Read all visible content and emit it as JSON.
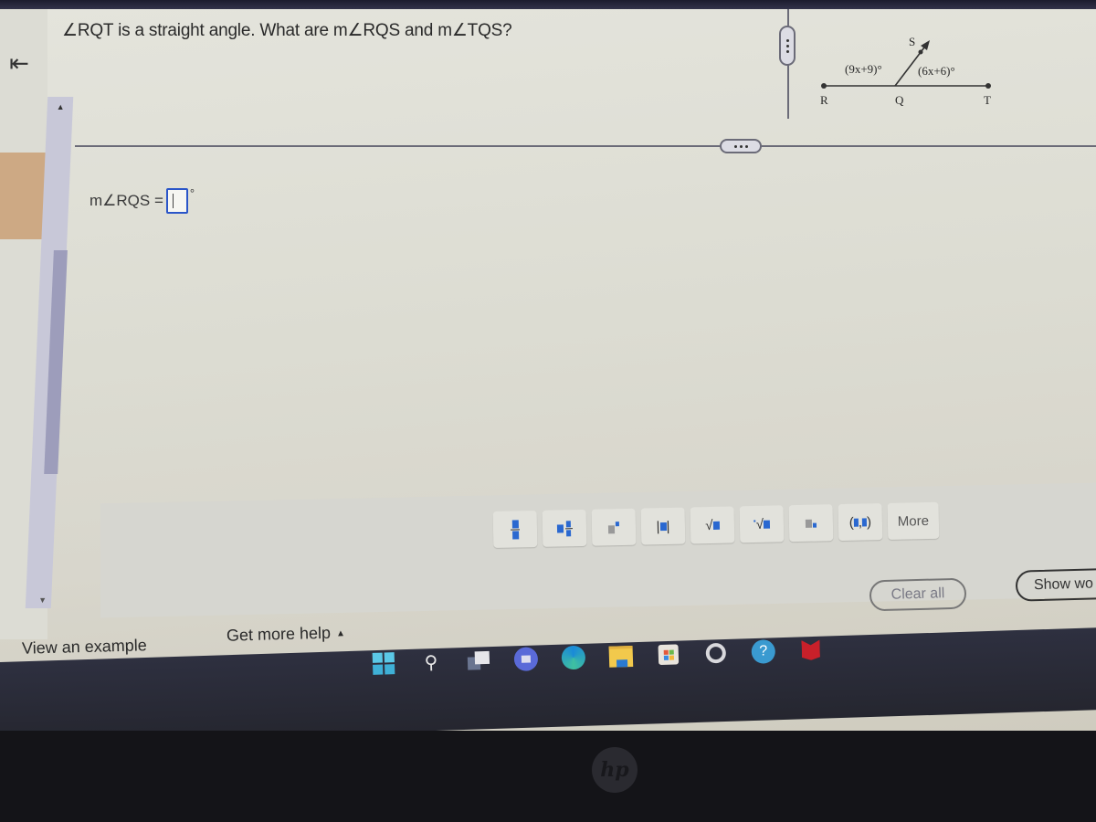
{
  "problem": {
    "question": "∠RQT is a straight angle. What are m∠RQS and m∠TQS?",
    "figure": {
      "points": [
        "R",
        "Q",
        "T",
        "S"
      ],
      "angle_left_label": "(9x+9)°",
      "angle_right_label": "(6x+6)°"
    }
  },
  "answer": {
    "label": "m∠RQS =",
    "value": "",
    "unit": "°"
  },
  "math_toolbar": {
    "buttons": [
      {
        "name": "fraction",
        "glyph": "▪/▪"
      },
      {
        "name": "mixed-number",
        "glyph": "▪▪/▪"
      },
      {
        "name": "exponent",
        "glyph": "▪ˣ"
      },
      {
        "name": "absolute-value",
        "glyph": "|▪|"
      },
      {
        "name": "square-root",
        "glyph": "√▪"
      },
      {
        "name": "nth-root",
        "glyph": "ⁿ√▪"
      },
      {
        "name": "decimal",
        "glyph": "▪."
      },
      {
        "name": "ordered-pair",
        "glyph": "(▪,▪)"
      }
    ],
    "more_label": "More"
  },
  "actions": {
    "clear_all": "Clear all",
    "show_work": "Show wo"
  },
  "footer": {
    "view_example": "View an example",
    "get_more_help": "Get more help",
    "help_caret": "▲"
  },
  "nav": {
    "back_icon": "⇤"
  },
  "taskbar": {
    "icons": [
      "windows-start",
      "search",
      "task-view",
      "teams-meet",
      "edge-browser",
      "file-explorer",
      "microsoft-store",
      "app-circle",
      "help-mail",
      "mcafee"
    ]
  },
  "colors": {
    "accent_blue": "#2a68d0",
    "input_border": "#2a55c8",
    "rail_accent": "#cda984",
    "scroll_thumb": "#9d9dbb"
  }
}
